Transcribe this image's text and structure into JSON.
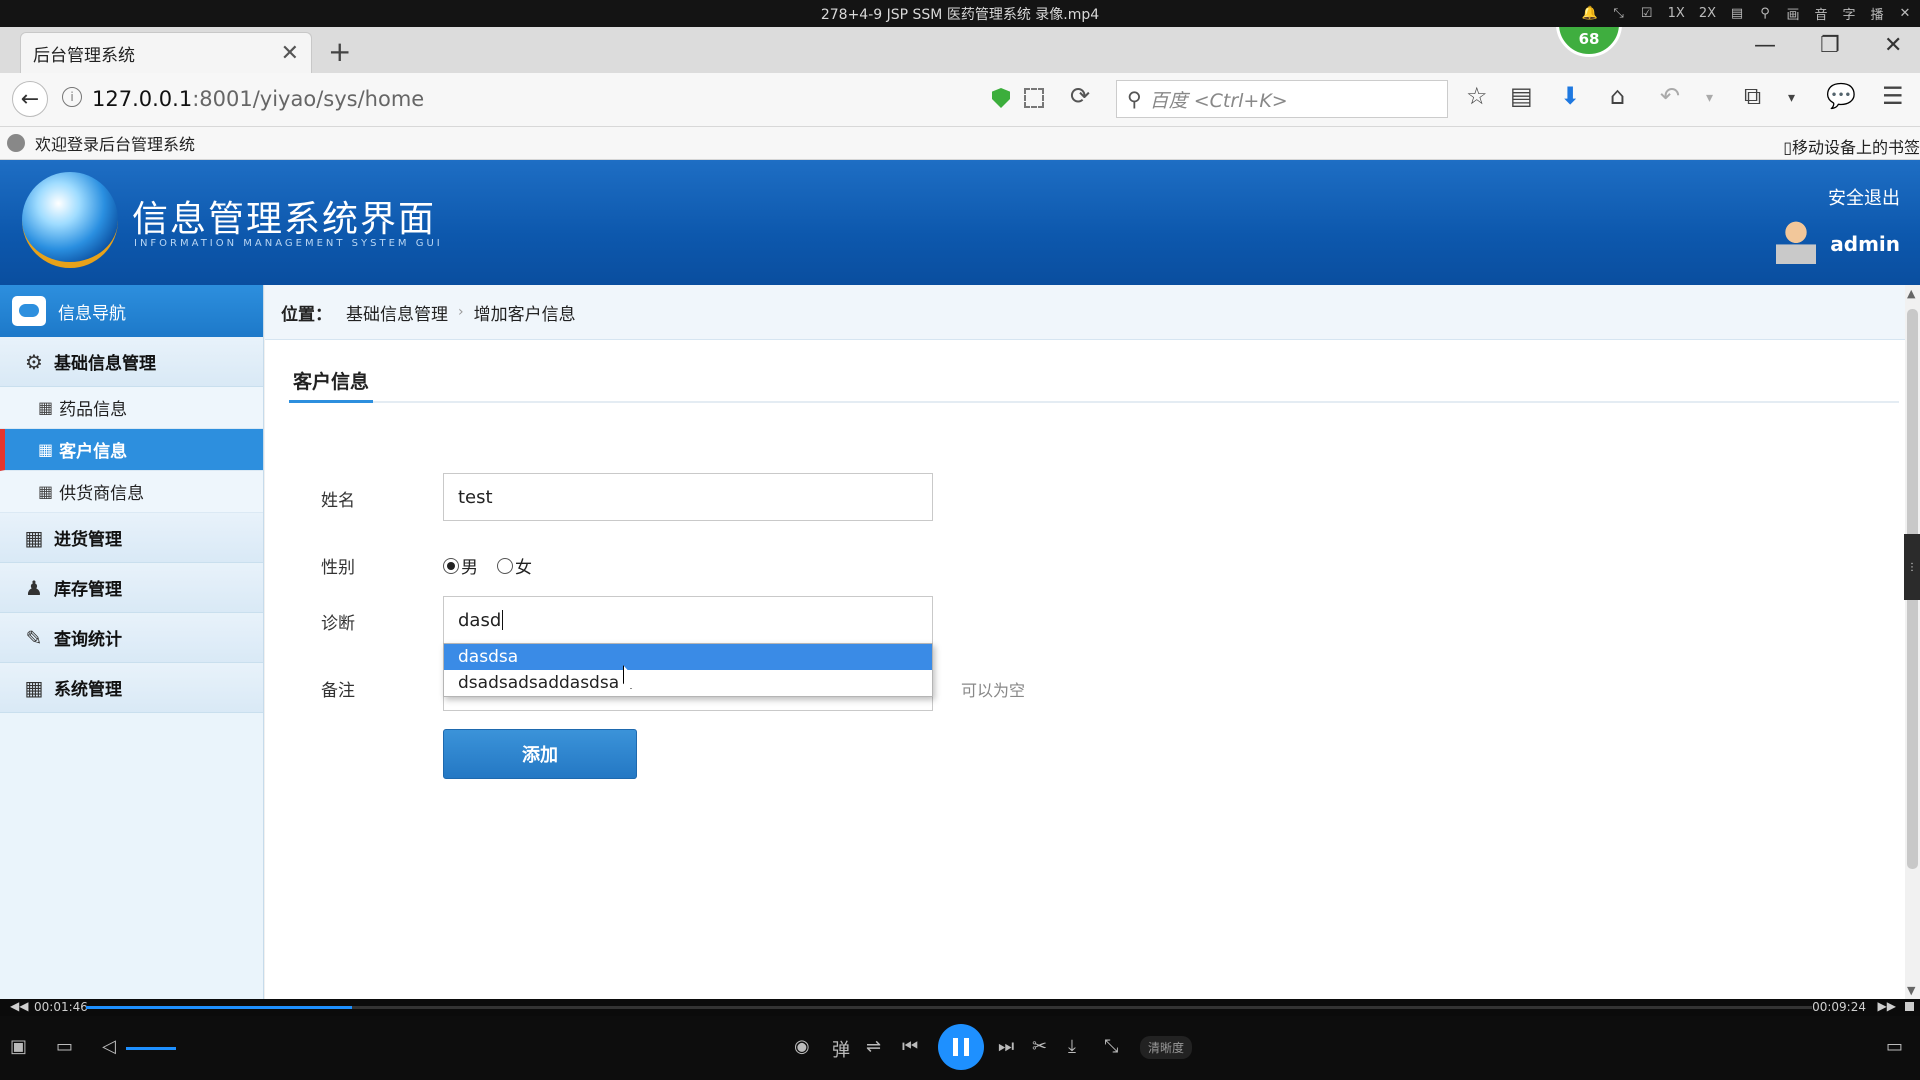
{
  "player": {
    "title": "278+4-9 JSP SSM 医药管理系统 录像.mp4",
    "tools": [
      "🔔",
      "⤡",
      "☑",
      "1X",
      "2X",
      "▤",
      "⚲",
      "画",
      "音",
      "字",
      "播",
      "✕"
    ],
    "time_current": "00:01:46",
    "time_total": "00:09:24",
    "progress": 0.154,
    "quality_label": "清晰度"
  },
  "browser": {
    "tab_title": "后台管理系统",
    "tab_close": "✕",
    "new_tab": "+",
    "score": "68",
    "win_min": "—",
    "win_restore": "❐",
    "win_close": "✕",
    "back": "←",
    "info": "i",
    "url_host": "127.0.0.1",
    "url_path": ":8001/yiyao/sys/home",
    "reload": "⟳",
    "search_icon": "⚲",
    "search_placeholder": "百度 <Ctrl+K>",
    "nav_icons": [
      "☆",
      "▤",
      "⬇",
      "⌂",
      "↶",
      "▾",
      "⧉",
      "▾",
      "💬",
      "☰"
    ],
    "bookmark_left": "欢迎登录后台管理系统",
    "bookmark_right": "▯移动设备上的书签"
  },
  "app": {
    "title": "信息管理系统界面",
    "subtitle": "INFORMATION MANAGEMENT SYSTEM GUI",
    "logout": "安全退出",
    "user": "admin"
  },
  "sidebar": {
    "header": "信息导航",
    "groups": [
      {
        "icon": "⚙",
        "label": "基础信息管理"
      },
      {
        "icon": "▦",
        "label": "进货管理"
      },
      {
        "icon": "♟",
        "label": "库存管理"
      },
      {
        "icon": "✎",
        "label": "查询统计"
      },
      {
        "icon": "▦",
        "label": "系统管理"
      }
    ],
    "items": [
      {
        "icon": "▦",
        "label": "药品信息"
      },
      {
        "icon": "▦",
        "label": "客户信息"
      },
      {
        "icon": "▦",
        "label": "供货商信息"
      }
    ]
  },
  "breadcrumb": {
    "label": "位置：",
    "level1": "基础信息管理",
    "sep": "›",
    "level2": "增加客户信息"
  },
  "form": {
    "tab": "客户信息",
    "name_label": "姓名",
    "name_value": "test",
    "gender_label": "性别",
    "gender_male": "男",
    "gender_female": "女",
    "diagnosis_label": "诊断",
    "diagnosis_value": "dasd",
    "autocomplete": [
      "dasdsa",
      "dsadsadsaddasdsa"
    ],
    "remark_label": "备注",
    "remark_hint": "可以为空",
    "submit": "添加"
  }
}
